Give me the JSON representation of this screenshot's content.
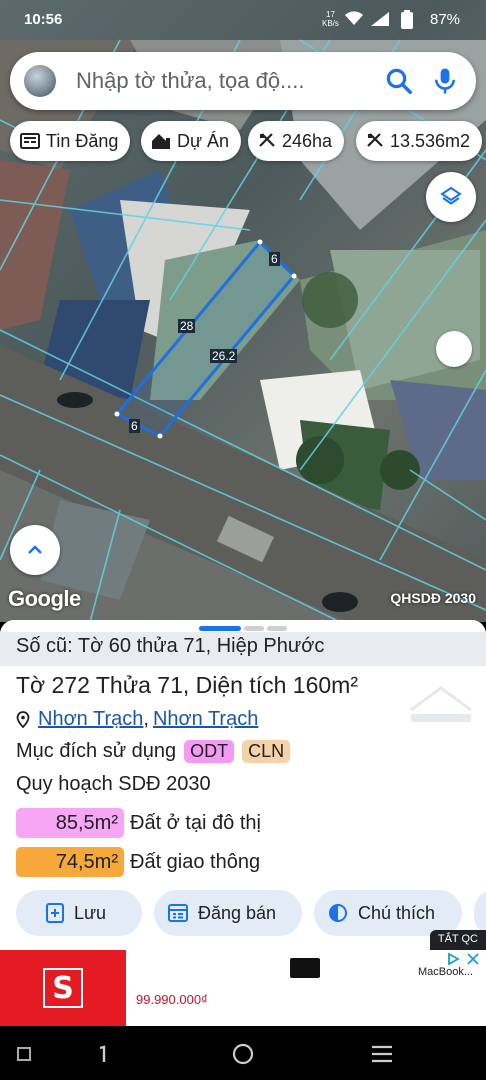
{
  "status_bar": {
    "time": "10:56",
    "net_speed": "17",
    "net_unit": "KB/s",
    "battery": "87%"
  },
  "search": {
    "placeholder": "Nhập tờ thửa, tọa độ...."
  },
  "chips": [
    {
      "icon": "newspaper-icon",
      "label": "Tin Đăng"
    },
    {
      "icon": "house-icon",
      "label": "Dự Án"
    },
    {
      "icon": "ruler-icon",
      "label": "246ha"
    },
    {
      "icon": "ruler-icon",
      "label": "13.536m2"
    }
  ],
  "map": {
    "dimensions": [
      "6",
      "28",
      "26.2",
      "6"
    ],
    "logo": "Google",
    "layer": "QHSDĐ 2030",
    "parcel_outline_color": "#1e6fe0"
  },
  "panel": {
    "old_id": "Số cũ: Tờ 60 thửa 71, Hiệp Phước",
    "title": "Tờ 272 Thửa 71, Diện tích 160m²",
    "location_1": "Nhơn Trạch",
    "location_sep": ",",
    "location_2": "Nhơn Trạch",
    "purpose_label": "Mục đích sử dụng",
    "tags": [
      {
        "label": "ODT",
        "color": "#f39af3"
      },
      {
        "label": "CLN",
        "color": "#f6d2a8"
      }
    ],
    "plan_label": "Quy hoạch SDĐ 2030",
    "areas": [
      {
        "value": "85,5m²",
        "label": "Đất ở tại đô thị",
        "color": "#f7a6f5"
      },
      {
        "value": "74,5m²",
        "label": "Đất giao thông",
        "color": "#f7a83a"
      }
    ],
    "actions": [
      {
        "icon": "add-bookmark-icon",
        "label": "Lưu"
      },
      {
        "icon": "calendar-list-icon",
        "label": "Đăng bán"
      },
      {
        "icon": "half-circle-icon",
        "label": "Chú thích"
      }
    ]
  },
  "ad": {
    "tag": "TẮT QC",
    "logo_letter": "S",
    "price": "99.990.000₫",
    "brand": "MacBook..."
  }
}
